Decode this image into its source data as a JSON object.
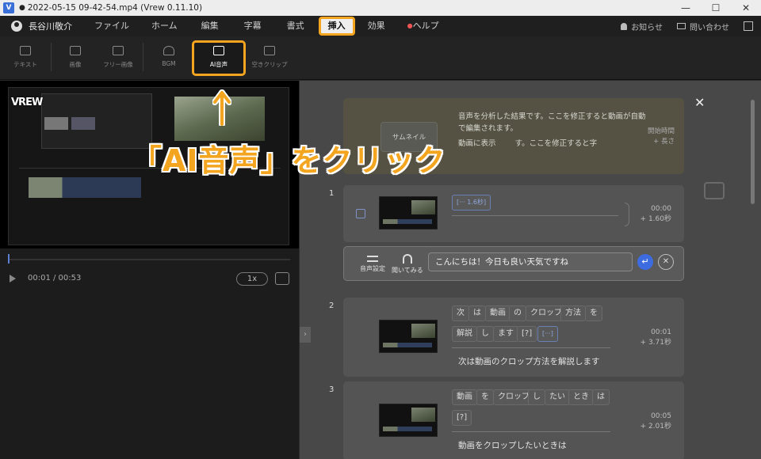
{
  "window": {
    "title": "2022-05-15 09-42-54.mp4 (Vrew 0.11.10)",
    "logo_letter": "V",
    "controls": [
      "—",
      "☐",
      "✕"
    ]
  },
  "menubar": {
    "user": "長谷川敬介",
    "items": [
      "ファイル",
      "ホーム",
      "編集",
      "字幕",
      "書式",
      "挿入",
      "効果",
      "ヘルプ"
    ],
    "active": "挿入",
    "right": [
      "お知らせ",
      "問い合わせ"
    ]
  },
  "toolbar": {
    "items": [
      {
        "label": "テキスト",
        "icon": "text-icon"
      },
      {
        "label": "画像",
        "icon": "image-icon"
      },
      {
        "label": "フリー画像",
        "icon": "free-image-icon"
      },
      {
        "label": "BGM",
        "icon": "music-icon"
      },
      {
        "label": "AI音声",
        "icon": "ai-voice-icon"
      },
      {
        "label": "空きクリップ",
        "icon": "empty-clip-icon"
      }
    ]
  },
  "preview": {
    "logo": "VREW",
    "time": "00:01 / 00:53",
    "speed": "1x"
  },
  "help_card": {
    "thumb_label": "サムネイル",
    "text1": "音声を分析した結果です。ここを修正すると動画が自動で編集されます。",
    "text2": "動画に表示",
    "text2_rest": "す。ここを修正すると字",
    "time_label": "開始時間",
    "length_label": "+ 長さ"
  },
  "clips": [
    {
      "num": "1",
      "tag": "[··· 1.6秒]",
      "start": "00:00",
      "length": "+ 1.60秒"
    },
    {
      "num": "2",
      "words": [
        "次",
        "は",
        "動画",
        "の",
        "クロップ",
        "方法",
        "を",
        "解説",
        "し",
        "ます",
        "[?]",
        "[···]"
      ],
      "start": "00:01",
      "length": "+ 3.71秒",
      "subtitle": "次は動画のクロップ方法を解説します"
    },
    {
      "num": "3",
      "words": [
        "動画",
        "を",
        "クロップ",
        "し",
        "たい",
        "とき",
        "は",
        "[?]"
      ],
      "start": "00:05",
      "length": "+ 2.01秒",
      "subtitle": "動画をクロップしたいときは"
    }
  ],
  "edit_card": {
    "voice_settings": "音声設定",
    "listen": "聞いてみる",
    "input_value": "こんにちは！今日も良い天気ですね"
  },
  "annotation": {
    "arrow": "↑",
    "text": "「AI音声」をクリック"
  },
  "colors": {
    "highlight": "#f3a51f",
    "accent_blue": "#3d6ce0"
  }
}
